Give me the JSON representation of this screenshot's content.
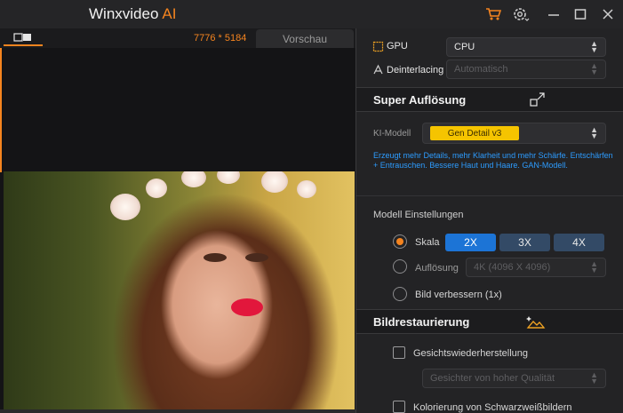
{
  "app": {
    "title": "Winxvideo",
    "title_suffix": "AI"
  },
  "titlebar": {
    "icons": [
      "cart-icon",
      "gear-icon",
      "minimize-icon",
      "maximize-icon",
      "close-icon"
    ],
    "accent": "#f5841f"
  },
  "preview": {
    "resolution": "7776 * 5184",
    "tab_label": "Vorschau"
  },
  "settings": {
    "gpu_label": "GPU",
    "gpu_value": "CPU",
    "deinterlacing_label": "Deinterlacing",
    "deinterlacing_value": "Automatisch"
  },
  "super_resolution": {
    "title": "Super Auflösung",
    "ki_model_label": "KI-Modell",
    "ki_model_value": "Gen Detail v3",
    "description": "Erzeugt mehr Details, mehr Klarheit und mehr Schärfe. Entschärfen + Entrauschen. Bessere Haut und Haare. GAN-Modell.",
    "model_settings_label": "Modell Einstellungen",
    "scale_label": "Skala",
    "scale_options": [
      "2X",
      "3X",
      "4X"
    ],
    "scale_selected": "2X",
    "resolution_label": "Auflösung",
    "resolution_value": "4K (4096 X 4096)",
    "enhance_label": "Bild verbessern (1x)"
  },
  "restoration": {
    "title": "Bildrestaurierung",
    "face_restore_label": "Gesichtswiederherstellung",
    "face_restore_value": "Gesichter von hoher Qualität",
    "colorize_label": "Kolorierung von Schwarzweißbildern"
  }
}
